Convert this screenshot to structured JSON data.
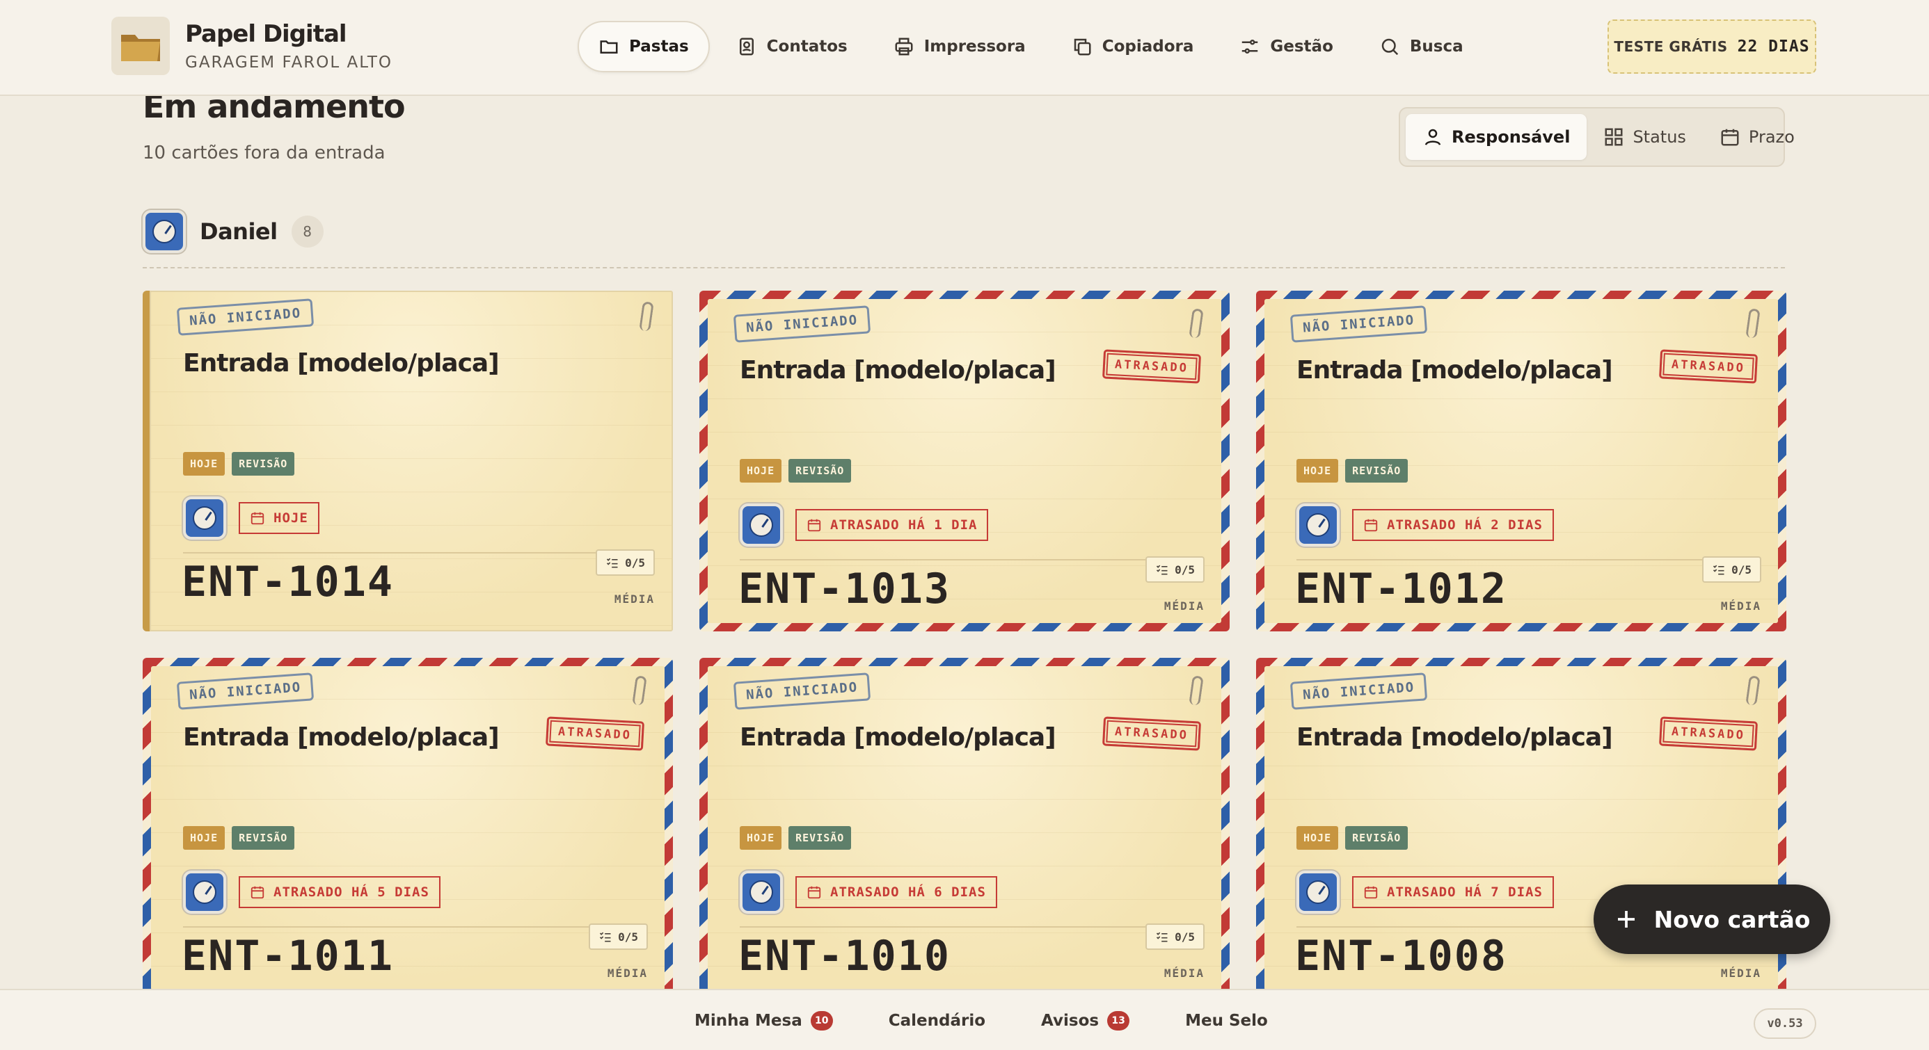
{
  "header": {
    "brand_name": "Papel Digital",
    "brand_sub": "GARAGEM FAROL ALTO",
    "nav": [
      {
        "label": "Pastas",
        "icon": "folder-icon",
        "active": true
      },
      {
        "label": "Contatos",
        "icon": "contacts-icon"
      },
      {
        "label": "Impressora",
        "icon": "printer-icon"
      },
      {
        "label": "Copiadora",
        "icon": "copy-icon"
      },
      {
        "label": "Gestão",
        "icon": "sliders-icon"
      },
      {
        "label": "Busca",
        "icon": "search-icon"
      }
    ],
    "trial_label": "TESTE GRÁTIS",
    "trial_days": "22 DIAS"
  },
  "section": {
    "title": "Em andamento",
    "subtitle": "10 cartões fora da entrada",
    "group_by": [
      {
        "label": "Responsável",
        "icon": "user-icon",
        "active": true
      },
      {
        "label": "Status",
        "icon": "grid-icon"
      },
      {
        "label": "Prazo",
        "icon": "calendar-icon"
      }
    ]
  },
  "group": {
    "name": "Daniel",
    "count": "8"
  },
  "cards": [
    {
      "status": "NÃO INICIADO",
      "title": "Entrada [modelo/placa]",
      "late": "",
      "tag1": "HOJE",
      "tag2": "REVISÃO",
      "due": "HOJE",
      "code": "ENT-1014",
      "checklist": "0/5",
      "priority": "MÉDIA",
      "style": "plain"
    },
    {
      "status": "NÃO INICIADO",
      "title": "Entrada [modelo/placa]",
      "late": "ATRASADO",
      "tag1": "HOJE",
      "tag2": "REVISÃO",
      "due": "ATRASADO HÁ 1 DIA",
      "code": "ENT-1013",
      "checklist": "0/5",
      "priority": "MÉDIA",
      "style": "airmail"
    },
    {
      "status": "NÃO INICIADO",
      "title": "Entrada [modelo/placa]",
      "late": "ATRASADO",
      "tag1": "HOJE",
      "tag2": "REVISÃO",
      "due": "ATRASADO HÁ 2 DIAS",
      "code": "ENT-1012",
      "checklist": "0/5",
      "priority": "MÉDIA",
      "style": "airmail"
    },
    {
      "status": "NÃO INICIADO",
      "title": "Entrada [modelo/placa]",
      "late": "ATRASADO",
      "tag1": "HOJE",
      "tag2": "REVISÃO",
      "due": "ATRASADO HÁ 5 DIAS",
      "code": "ENT-1011",
      "checklist": "0/5",
      "priority": "MÉDIA",
      "style": "airmail"
    },
    {
      "status": "NÃO INICIADO",
      "title": "Entrada [modelo/placa]",
      "late": "ATRASADO",
      "tag1": "HOJE",
      "tag2": "REVISÃO",
      "due": "ATRASADO HÁ 6 DIAS",
      "code": "ENT-1010",
      "checklist": "0/5",
      "priority": "MÉDIA",
      "style": "airmail"
    },
    {
      "status": "NÃO INICIADO",
      "title": "Entrada [modelo/placa]",
      "late": "ATRASADO",
      "tag1": "HOJE",
      "tag2": "REVISÃO",
      "due": "ATRASADO HÁ 7 DIAS",
      "code": "ENT-1008",
      "checklist": "",
      "priority": "MÉDIA",
      "style": "airmail"
    }
  ],
  "fab_label": "Novo cartão",
  "bottom": {
    "items": [
      {
        "label": "Minha Mesa",
        "badge": "10"
      },
      {
        "label": "Calendário",
        "badge": ""
      },
      {
        "label": "Avisos",
        "badge": "13"
      },
      {
        "label": "Meu Selo",
        "badge": ""
      }
    ],
    "version": "v0.53"
  },
  "colors": {
    "accent_red": "#c63b36",
    "accent_blue": "#2e5fa8",
    "paper": "#f6e8bd",
    "tag_today": "#c79540",
    "tag_review": "#5e7f6a"
  }
}
